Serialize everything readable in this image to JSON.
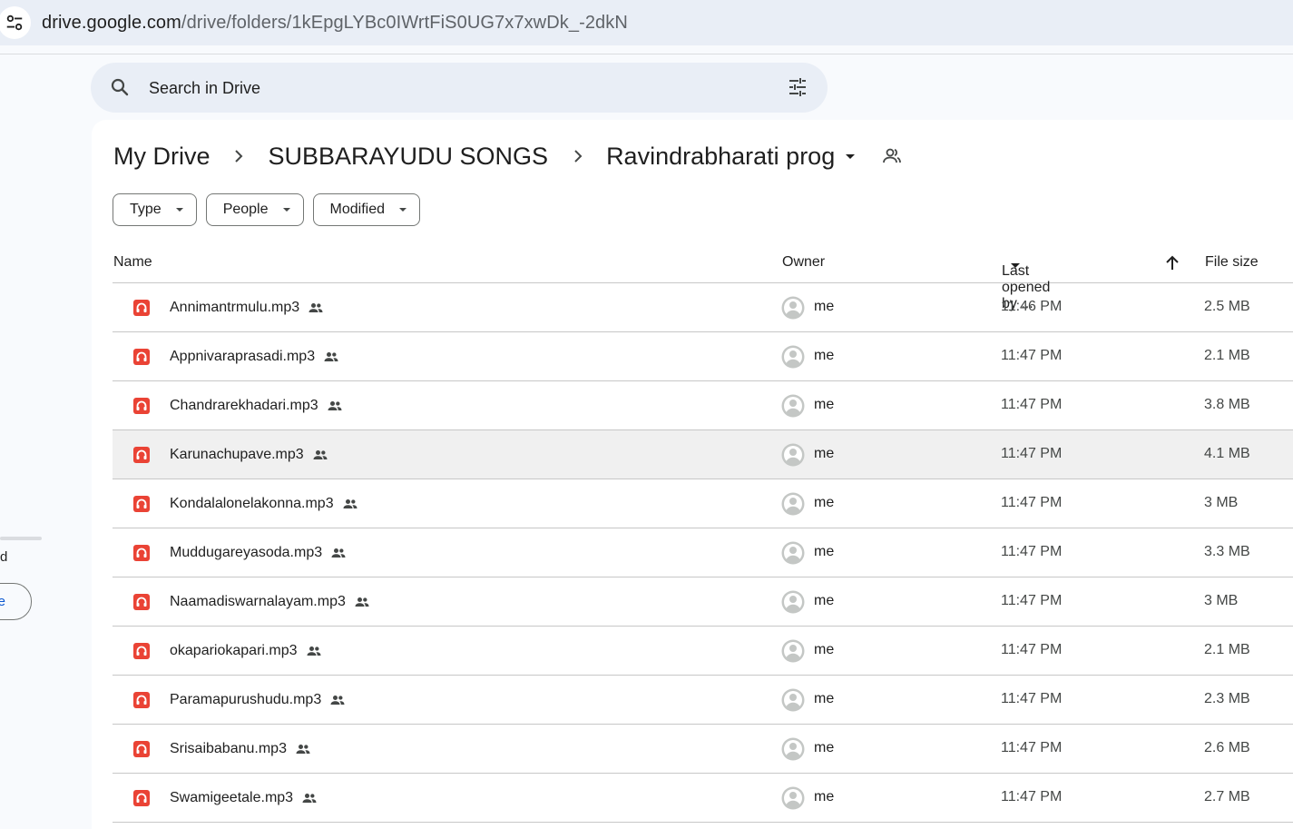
{
  "browser": {
    "url_host": "drive.google.com",
    "url_path": "/drive/folders/1kEpgLYBc0IWrtFiS0UG7x7xwDk_-2dkN"
  },
  "sidebar": {
    "partial_text": "d",
    "partial_button": "e"
  },
  "search": {
    "placeholder": "Search in Drive"
  },
  "breadcrumb": {
    "items": [
      "My Drive",
      "SUBBARAYUDU SONGS",
      "Ravindrabharati prog"
    ]
  },
  "filters": {
    "type": "Type",
    "people": "People",
    "modified": "Modified"
  },
  "table": {
    "columns": {
      "name": "Name",
      "owner": "Owner",
      "last_opened": "Last opened by ...",
      "file_size": "File size"
    },
    "rows": [
      {
        "name": "Annimantrmulu.mp3",
        "owner": "me",
        "time": "11:46 PM",
        "size": "2.5 MB"
      },
      {
        "name": "Appnivaraprasadi.mp3",
        "owner": "me",
        "time": "11:47 PM",
        "size": "2.1 MB"
      },
      {
        "name": "Chandrarekhadari.mp3",
        "owner": "me",
        "time": "11:47 PM",
        "size": "3.8 MB"
      },
      {
        "name": "Karunachupave.mp3",
        "owner": "me",
        "time": "11:47 PM",
        "size": "4.1 MB"
      },
      {
        "name": "Kondalalonelakonna.mp3",
        "owner": "me",
        "time": "11:47 PM",
        "size": "3 MB"
      },
      {
        "name": "Muddugareyasoda.mp3",
        "owner": "me",
        "time": "11:47 PM",
        "size": "3.3 MB"
      },
      {
        "name": "Naamadiswarnalayam.mp3",
        "owner": "me",
        "time": "11:47 PM",
        "size": "3 MB"
      },
      {
        "name": "okapariokapari.mp3",
        "owner": "me",
        "time": "11:47 PM",
        "size": "2.1 MB"
      },
      {
        "name": "Paramapurushudu.mp3",
        "owner": "me",
        "time": "11:47 PM",
        "size": "2.3 MB"
      },
      {
        "name": "Srisaibabanu.mp3",
        "owner": "me",
        "time": "11:47 PM",
        "size": "2.6 MB"
      },
      {
        "name": "Swamigeetale.mp3",
        "owner": "me",
        "time": "11:47 PM",
        "size": "2.7 MB"
      }
    ]
  },
  "colors": {
    "audio_icon": "#ea4335",
    "accent": "#0b57d0",
    "hover_row": "#f0f0f0"
  },
  "icons": {
    "site_info": "tune-site-info-icon",
    "search": "search-icon",
    "search_options": "tune-icon",
    "breadcrumb_separator": "chevron-right-icon",
    "folder_menu": "caret-down-icon",
    "folder_shared": "shared-folder-icon",
    "sort": "arrow-up-icon",
    "file": "audio-file-icon",
    "shared": "shared-people-icon",
    "owner_avatar": "account-circle-icon"
  }
}
